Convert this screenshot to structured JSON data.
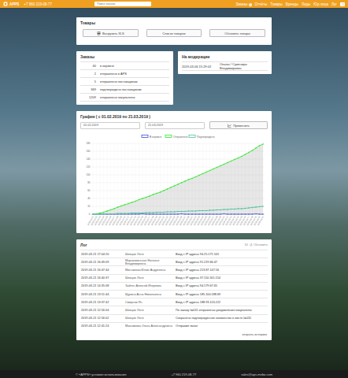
{
  "header": {
    "logo": "APPS",
    "phone": "+7 960 219-08-77",
    "search": {
      "placeholder": "Поиск заказа"
    },
    "nav": [
      {
        "label": "Заказы",
        "badge": "3"
      },
      {
        "label": "Отчёты"
      },
      {
        "label": "Товары"
      },
      {
        "label": "Бренды"
      },
      {
        "label": "Лиды"
      },
      {
        "label": "Юр.лица"
      },
      {
        "label": "Лог"
      }
    ],
    "logout": "⏻"
  },
  "products": {
    "title": "Товары",
    "buttons": [
      "Выгрузить XLS",
      "Список товаров",
      "Обновить товары"
    ]
  },
  "orders": {
    "title": "Заказы",
    "rows": [
      [
        "40",
        "в корзине"
      ],
      [
        "2",
        "отправлено в APS"
      ],
      [
        "5",
        "отправлено поставщикам"
      ],
      [
        "369",
        "подтверждено поставщиком"
      ],
      [
        "1209",
        "отправлено покупателю"
      ]
    ]
  },
  "moderation": {
    "title": "На модерации",
    "rows": [
      [
        "2019-03-06 15:29:02",
        "Опалы / Сувениры Владимирович"
      ]
    ]
  },
  "chart": {
    "title": "График ( с 01.02.2019 по 21.03.2019 )",
    "from": "01.02.2019",
    "to": "21.03.2019",
    "apply": "Применить",
    "y_ticks": [
      "0",
      "20",
      "40",
      "60",
      "80",
      "100",
      "120",
      "140",
      "160",
      "180"
    ],
    "x_labels": [
      "2019-02-01",
      "2019-02-02",
      "2019-02-03",
      "2019-02-04",
      "2019-02-05",
      "2019-02-06",
      "2019-02-07",
      "2019-02-08",
      "2019-02-09",
      "2019-02-10",
      "2019-02-11",
      "2019-02-12",
      "2019-02-13",
      "2019-02-14",
      "2019-02-15",
      "2019-02-16",
      "2019-02-17",
      "2019-02-18",
      "2019-02-19",
      "2019-02-20",
      "2019-02-21",
      "2019-02-22",
      "2019-02-23",
      "2019-02-24",
      "2019-02-25",
      "2019-02-26",
      "2019-02-27",
      "2019-02-28",
      "2019-03-01",
      "2019-03-02",
      "2019-03-03",
      "2019-03-04",
      "2019-03-05",
      "2019-03-06",
      "2019-03-07",
      "2019-03-08",
      "2019-03-09",
      "2019-03-10",
      "2019-03-11",
      "2019-03-12",
      "2019-03-13",
      "2019-03-14",
      "2019-03-15",
      "2019-03-16",
      "2019-03-17",
      "2019-03-18",
      "2019-03-19",
      "2019-03-20",
      "2019-03-21"
    ],
    "series": [
      {
        "name": "В корзине",
        "color": "#3b4fd8",
        "values": [
          0,
          0,
          0,
          0,
          0,
          0,
          0,
          0,
          0,
          0,
          0,
          0,
          0,
          0,
          1,
          0,
          0,
          0,
          0,
          0,
          0,
          0,
          0,
          0,
          0,
          1,
          0,
          0,
          0,
          0,
          0,
          0,
          0,
          0,
          0,
          0,
          0,
          1,
          0,
          0,
          0,
          0,
          0,
          0,
          0,
          0,
          1,
          0,
          0
        ]
      },
      {
        "name": "Отправлено",
        "color": "#2ee82e",
        "values": [
          0,
          1,
          3,
          5,
          8,
          11,
          14,
          18,
          21,
          24,
          27,
          30,
          33,
          37,
          40,
          43,
          46,
          50,
          53,
          56,
          60,
          64,
          68,
          72,
          76,
          80,
          84,
          88,
          91,
          95,
          99,
          103,
          107,
          111,
          115,
          119,
          123,
          127,
          131,
          135,
          139,
          143,
          147,
          152,
          157,
          162,
          168,
          174,
          178
        ]
      },
      {
        "name": "Подтверждено",
        "color": "#4fc3a1",
        "values": [
          0,
          0,
          0,
          1,
          1,
          1,
          1,
          2,
          2,
          2,
          2,
          3,
          3,
          3,
          3,
          4,
          4,
          4,
          5,
          5,
          5,
          6,
          6,
          6,
          7,
          7,
          7,
          8,
          8,
          8,
          9,
          9,
          9,
          10,
          10,
          11,
          11,
          12,
          12,
          13,
          13,
          14,
          14,
          15,
          16,
          17,
          18,
          19,
          20
        ]
      }
    ]
  },
  "log": {
    "title": "Лог",
    "count": "10",
    "refresh": "Обновить",
    "more": "открыть историю",
    "rows": [
      [
        "2019-03-21 17:04:20",
        "Шевцов Леня",
        "Вход с IP адреса 94.25.171.105"
      ],
      [
        "2019-03-21 16:49:09",
        "Мараковинская Наталья Владимировна",
        "Вход с IP адреса 91.219.66.47"
      ],
      [
        "2019-03-21 16:47:44",
        "Минникова Юлия Андреевна",
        "Вход с IP адреса 213.87.147.56"
      ],
      [
        "2019-03-21 16:40:37",
        "Шевцов Леня",
        "Вход с IP адреса 37.110.161.154"
      ],
      [
        "2019-03-21 14:35:08",
        "Зайтен Алексей Игоревич",
        "Вход с IP адреса 94.179.67.65"
      ],
      [
        "2019-03-21 13:51:44",
        "Щукина Анна Николаевна",
        "Вход с IP адреса 185.100.188.69"
      ],
      [
        "2019-03-21 13:37:42",
        "Смирнов Ян",
        "Вход с IP адреса 188.93.120.222"
      ],
      [
        "2019-03-21 12:56:04",
        "Шевцов Леня",
        "По заказу №011 отправлены уведомления покупателю"
      ],
      [
        "2019-03-21 12:56:02",
        "Шевцов Леня",
        "Сохранено подтверждённое количество в листе №011"
      ],
      [
        "2019-03-21 12:41:24",
        "Максимова Ольга Александровна",
        "Отправил заказ"
      ]
    ]
  },
  "footer": {
    "copyright": "© «APPS» условия использования",
    "phone": "+7 960 219-08-77",
    "email": "sales@aps-mebo.com"
  }
}
